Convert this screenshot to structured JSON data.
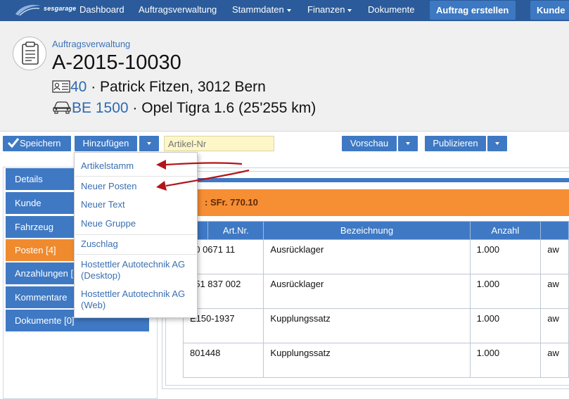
{
  "navbar": {
    "brand": "sesgarage",
    "items": [
      {
        "label": "Dashboard",
        "dropdown": false
      },
      {
        "label": "Auftragsverwaltung",
        "dropdown": false
      },
      {
        "label": "Stammdaten",
        "dropdown": true
      },
      {
        "label": "Finanzen",
        "dropdown": true
      },
      {
        "label": "Dokumente",
        "dropdown": false
      }
    ],
    "create_order": "Auftrag erstellen",
    "customer": "Kunde"
  },
  "header": {
    "breadcrumb": "Auftragsverwaltung",
    "order_number": "A-2015-10030",
    "customer_id": "40",
    "customer_text": " · Patrick Fitzen, 3012 Bern",
    "plate": "BE 1500",
    "vehicle_text": " · Opel Tigra 1.6 (25'255 km)"
  },
  "toolbar": {
    "save": "Speichern",
    "add": "Hinzufügen",
    "article_placeholder": "Artikel-Nr",
    "preview": "Vorschau",
    "publish": "Publizieren"
  },
  "add_menu": {
    "items": [
      "Artikelstamm",
      "Neuer Posten",
      "Neuer Text",
      "Neue Gruppe",
      "Zuschlag",
      "Hostettler Autotechnik AG (Desktop)",
      "Hostettler Autotechnik AG (Web)"
    ]
  },
  "tabs": [
    {
      "label": "Details",
      "active": false
    },
    {
      "label": "Kunde",
      "active": false
    },
    {
      "label": "Fahrzeug",
      "active": false
    },
    {
      "label": "Posten [4]",
      "active": true
    },
    {
      "label": "Anzahlungen [",
      "active": false
    },
    {
      "label": "Kommentare",
      "active": false
    },
    {
      "label": "Dokumente [0]",
      "active": false
    }
  ],
  "summary": {
    "total": ": SFr. 770.10"
  },
  "table": {
    "columns": [
      "Art.Nr.",
      "Bezeichnung",
      "Anzahl",
      ""
    ],
    "rows": [
      {
        "art_nr": "00 0671 11",
        "bezeichnung": "Ausrücklager",
        "anzahl": "1.000",
        "unit": "aw"
      },
      {
        "art_nr": "351 837 002",
        "bezeichnung": "Ausrücklager",
        "anzahl": "1.000",
        "unit": "aw"
      },
      {
        "art_nr": "E150-1937",
        "bezeichnung": "Kupplungssatz",
        "anzahl": "1.000",
        "unit": "aw"
      },
      {
        "art_nr": "801448",
        "bezeichnung": "Kupplungssatz",
        "anzahl": "1.000",
        "unit": "aw"
      }
    ]
  },
  "colors": {
    "navbar": "#2b5b9a",
    "primary": "#3f79c4",
    "active_tab": "#f08a2e",
    "total_bar": "#f68e34",
    "annotation_arrow": "#b3141a",
    "input_bg": "#fcf6c8"
  }
}
